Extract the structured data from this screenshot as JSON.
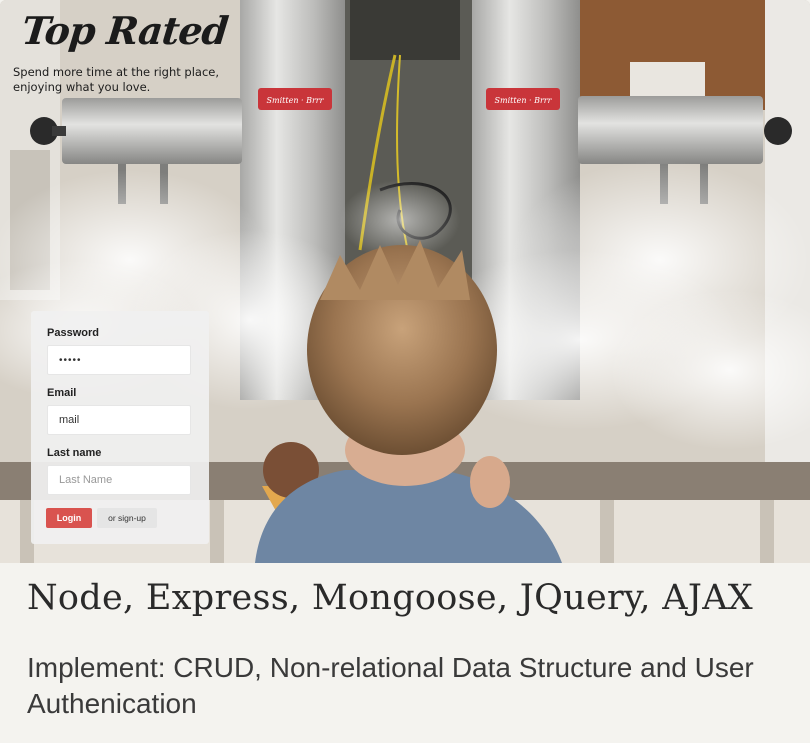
{
  "hero": {
    "logo_text": "Top Rated",
    "tagline": "Spend more time at the right place, enjoying what you love.",
    "machine_badge_left": "Smitten · Brrr",
    "machine_badge_right": "Smitten · Brrr"
  },
  "login_form": {
    "password_label": "Password",
    "password_value": "•••••",
    "email_label": "Email",
    "email_value": "mail",
    "last_name_label": "Last name",
    "last_name_placeholder": "Last Name",
    "login_button": "Login",
    "signup_button": "or sign-up"
  },
  "caption": {
    "title": "Node, Express, Mongoose, JQuery, AJAX",
    "description": "Implement: CRUD, Non-relational Data Structure and User Authenication"
  },
  "colors": {
    "login_button": "#d9534f",
    "caption_background": "#f4f3ef",
    "badge_red": "#c9353a"
  }
}
